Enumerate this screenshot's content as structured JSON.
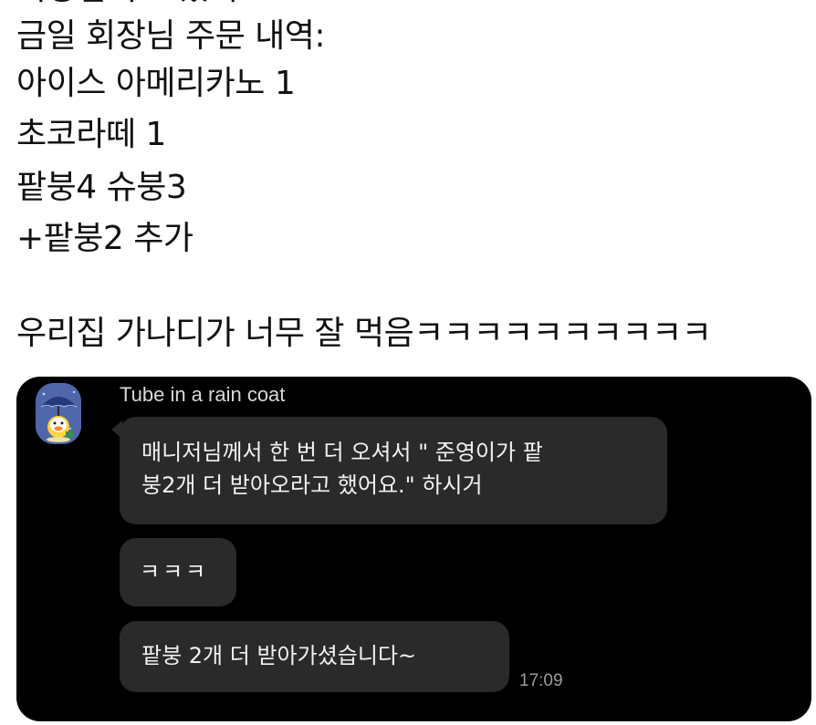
{
  "post": {
    "top_partial": "회장님이 오셨어",
    "lines": [
      "금일 회장님 주문 내역:",
      "아이스 아메리카노 1",
      "초코라떼 1",
      "팥붕4 슈붕3",
      "+팥붕2 추가",
      "우리집 가나디가 너무 잘 먹음ㅋㅋㅋㅋㅋㅋㅋㅋㅋㅋ"
    ]
  },
  "chat": {
    "sender_name": "Tube in a rain coat",
    "avatar_icon": "duck-with-umbrella-avatar",
    "messages": [
      {
        "line1": "매니저님께서 한 번 더 오셔서 \" 준영이가 팥",
        "line2": "붕2개 더 받아오라고 했어요.\" 하시거"
      },
      {
        "text": "ㅋㅋㅋ"
      },
      {
        "text": "팥붕 2개 더 받아가셨습니다~"
      }
    ],
    "time": "17:09"
  },
  "colors": {
    "page_background": "#ffffff",
    "text": "#111111",
    "chat_background": "#000000",
    "bubble_background": "#2a2a2a",
    "bubble_text": "#f2f2f2",
    "timestamp": "#9b9b9b"
  }
}
